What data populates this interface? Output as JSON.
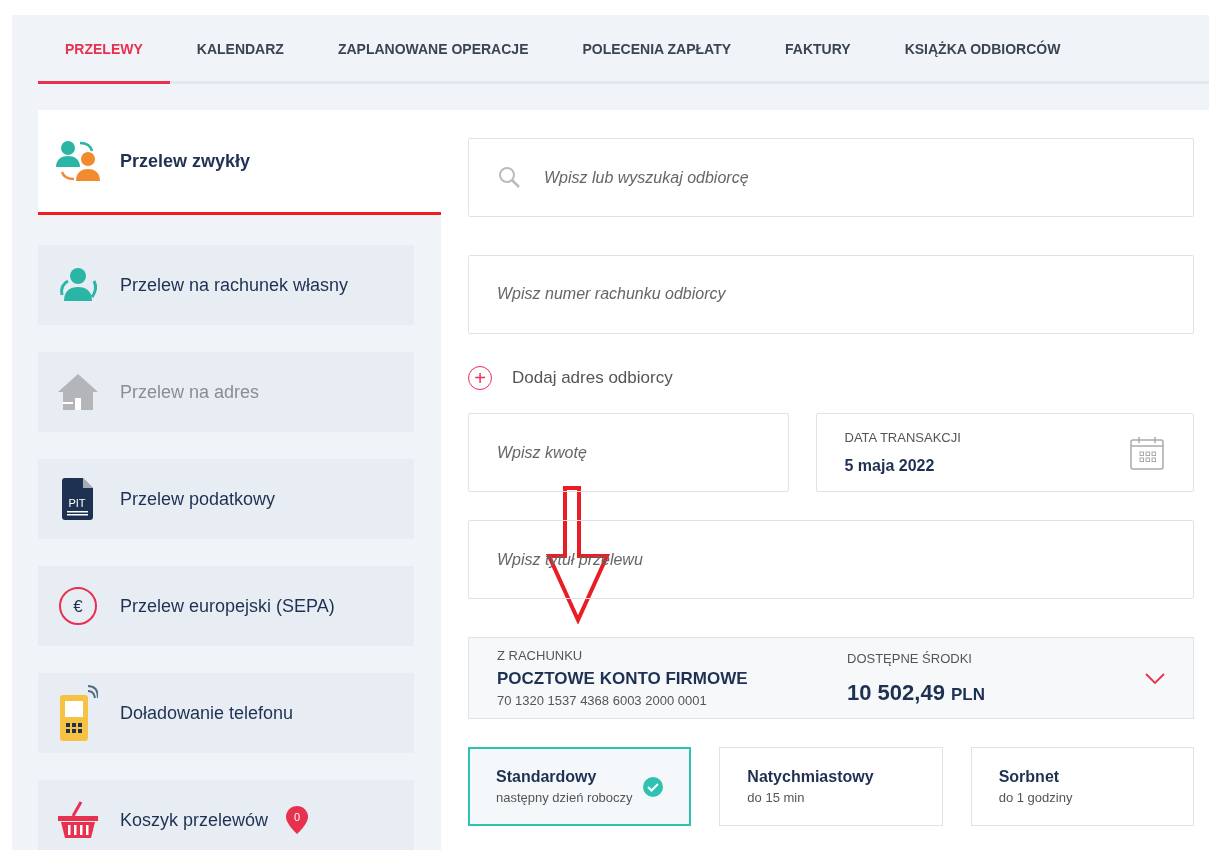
{
  "tabs": [
    {
      "label": "PRZELEWY",
      "selected": true
    },
    {
      "label": "KALENDARZ",
      "selected": false
    },
    {
      "label": "ZAPLANOWANE OPERACJE",
      "selected": false
    },
    {
      "label": "POLECENIA ZAPŁATY",
      "selected": false
    },
    {
      "label": "FAKTURY",
      "selected": false
    },
    {
      "label": "KSIĄŻKA ODBIORCÓW",
      "selected": false
    }
  ],
  "sidebar": {
    "items": [
      {
        "kind": "domestic",
        "label": "Przelew zwykły",
        "selected": true,
        "disabled": false
      },
      {
        "kind": "own",
        "label": "Przelew na rachunek własny",
        "selected": false,
        "disabled": false
      },
      {
        "kind": "address",
        "label": "Przelew na adres",
        "selected": false,
        "disabled": true
      },
      {
        "kind": "tax",
        "label": "Przelew podatkowy",
        "selected": false,
        "disabled": false,
        "icon_text": "PIT"
      },
      {
        "kind": "sepa",
        "label": "Przelew europejski (SEPA)",
        "selected": false,
        "disabled": false,
        "icon_text": "€"
      },
      {
        "kind": "topup",
        "label": "Doładowanie telefonu",
        "selected": false,
        "disabled": false
      },
      {
        "kind": "basket",
        "label": "Koszyk przelewów",
        "selected": false,
        "disabled": false,
        "badge": "0"
      }
    ]
  },
  "form": {
    "recipient_search": {
      "placeholder": "Wpisz lub wyszukaj odbiorcę"
    },
    "account_number": {
      "placeholder": "Wpisz numer rachunku odbiorcy"
    },
    "add_address": {
      "label": "Dodaj adres odbiorcy",
      "icon_text": "+"
    },
    "amount": {
      "placeholder": "Wpisz kwotę"
    },
    "date": {
      "label": "DATA TRANSAKCJI",
      "value": "5 maja 2022"
    },
    "title": {
      "placeholder": "Wpisz tytuł przelewu"
    },
    "from_account": {
      "label": "Z RACHUNKU",
      "name": "POCZTOWE KONTO FIRMOWE",
      "number": "70 1320 1537 4368 6003 2000 0001",
      "funds_label": "DOSTĘPNE ŚRODKI",
      "funds": "10 502,49",
      "currency": "PLN"
    },
    "options": [
      {
        "title": "Standardowy",
        "subtitle": "następny dzień roboczy",
        "selected": true
      },
      {
        "title": "Natychmiastowy",
        "subtitle": "do 15 min",
        "selected": false
      },
      {
        "title": "Sorbnet",
        "subtitle": "do 1 godziny",
        "selected": false
      }
    ]
  }
}
